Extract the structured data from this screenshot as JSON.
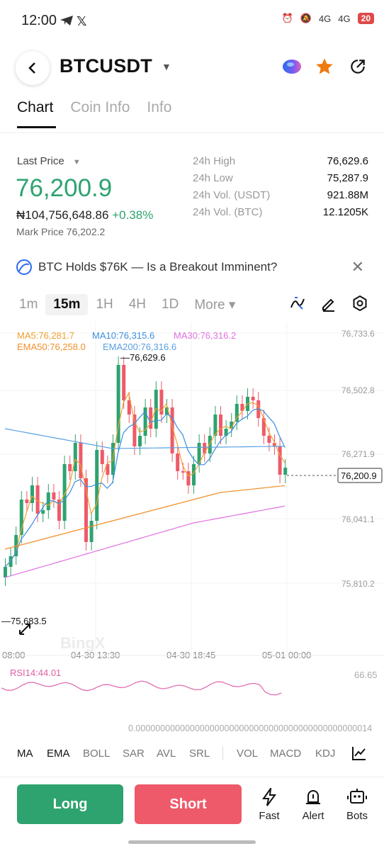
{
  "status_bar": {
    "time": "12:00",
    "net1": "4G",
    "net2": "4G",
    "battery": "20"
  },
  "header": {
    "pair": "BTCUSDT"
  },
  "tabs": [
    {
      "label": "Chart"
    },
    {
      "label": "Coin Info"
    },
    {
      "label": "Info"
    }
  ],
  "ticker": {
    "last_price_label": "Last Price",
    "price": "76,200.9",
    "local_price": "₦104,756,648.86",
    "change": "+0.38%",
    "mark_price": "Mark Price 76,202.2"
  },
  "stats": [
    {
      "k": "24h High",
      "v": "76,629.6"
    },
    {
      "k": "24h Low",
      "v": "75,287.9"
    },
    {
      "k": "24h Vol. (USDT)",
      "v": "921.88M"
    },
    {
      "k": "24h Vol. (BTC)",
      "v": "12.1205K"
    }
  ],
  "news": {
    "text": "BTC Holds $76K — Is a Breakout Imminent?"
  },
  "timeframes": [
    {
      "label": "1m"
    },
    {
      "label": "15m"
    },
    {
      "label": "1H"
    },
    {
      "label": "4H"
    },
    {
      "label": "1D"
    },
    {
      "label": "More ▾"
    }
  ],
  "chart": {
    "ma5": "MA5:76,281.7",
    "ma10": "MA10:76,315.6",
    "ma30": "MA30:76,316.2",
    "ema50": "EMA50:76,258.0",
    "ema200": "EMA200:76,316.6",
    "high_marker": "76,629.6",
    "low_marker": "75,683.5",
    "current_tag": "76,200.9",
    "watermark": "BingX",
    "y_ticks": [
      "76,733.6",
      "76,502.8",
      "76,271.9",
      "76,041.1",
      "75,810.2"
    ],
    "x_ticks": [
      "08:00",
      "04-30 13:30",
      "04-30 18:45",
      "05-01 00:00"
    ],
    "rsi_label": "RSI14:44.01",
    "rsi_top": "66.65",
    "rsi_bottom": "0.000000000000000000000000000000000000000000000014",
    "colors": {
      "up": "#2ea36f",
      "down": "#ee5a6a",
      "ma5": "#f0a030",
      "ma10": "#3a8ee0",
      "ma30": "#e070e0",
      "ema50": "#f0902a",
      "ema200": "#5aa0e0"
    }
  },
  "indicators": [
    "MA",
    "EMA",
    "BOLL",
    "SAR",
    "AVL",
    "SRL",
    "VOL",
    "MACD",
    "KDJ"
  ],
  "bottom": {
    "long": "Long",
    "short": "Short",
    "fast": "Fast",
    "alert": "Alert",
    "bots": "Bots"
  }
}
